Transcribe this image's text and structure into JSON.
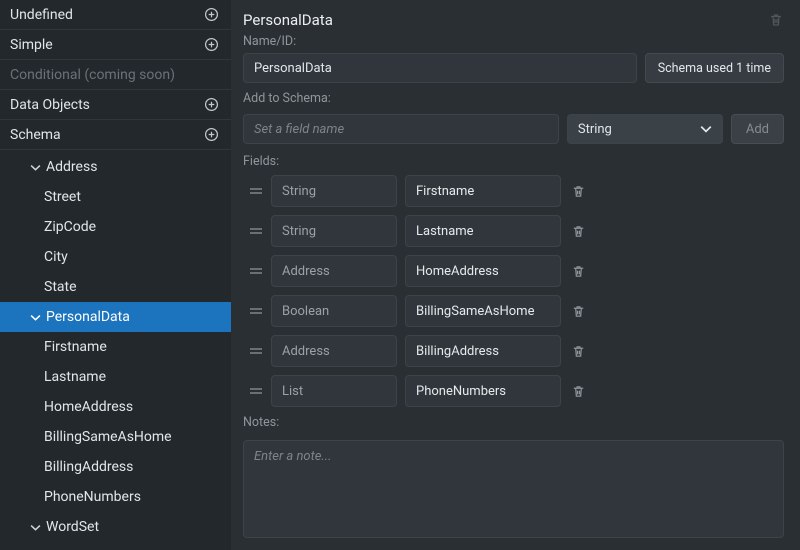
{
  "sidebar": {
    "sections": [
      {
        "label": "Undefined",
        "add": true,
        "disabled": false
      },
      {
        "label": "Simple",
        "add": true,
        "disabled": false
      },
      {
        "label": "Conditional (coming soon)",
        "add": false,
        "disabled": true
      },
      {
        "label": "Data Objects",
        "add": true,
        "disabled": false
      },
      {
        "label": "Schema",
        "add": true,
        "disabled": false
      }
    ],
    "schema_tree": {
      "address": {
        "label": "Address",
        "children": [
          "Street",
          "ZipCode",
          "City",
          "State"
        ]
      },
      "personaldata": {
        "label": "PersonalData",
        "children": [
          "Firstname",
          "Lastname",
          "HomeAddress",
          "BillingSameAsHome",
          "BillingAddress",
          "PhoneNumbers"
        ]
      },
      "wordset": {
        "label": "WordSet"
      }
    }
  },
  "editor": {
    "title": "PersonalData",
    "name_label": "Name/ID:",
    "name_value": "PersonalData",
    "usage_badge": "Schema used 1 time",
    "add_label": "Add to Schema:",
    "add_placeholder": "Set a field name",
    "type_selected": "String",
    "add_button": "Add",
    "fields_label": "Fields:",
    "fields": [
      {
        "type": "String",
        "name": "Firstname"
      },
      {
        "type": "String",
        "name": "Lastname"
      },
      {
        "type": "Address",
        "name": "HomeAddress"
      },
      {
        "type": "Boolean",
        "name": "BillingSameAsHome"
      },
      {
        "type": "Address",
        "name": "BillingAddress"
      },
      {
        "type": "List",
        "name": "PhoneNumbers"
      }
    ],
    "notes_label": "Notes:",
    "notes_placeholder": "Enter a note..."
  }
}
